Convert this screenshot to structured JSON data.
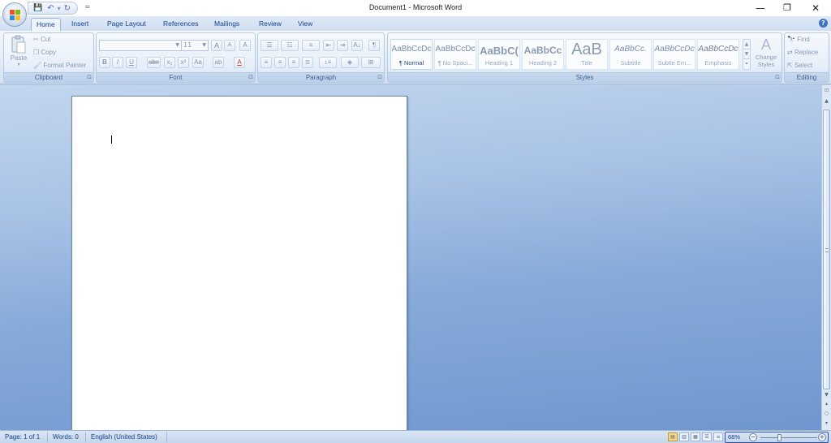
{
  "window": {
    "title": "Document1 - Microsoft Word",
    "controls": {
      "minimize": "—",
      "restore": "❐",
      "close": "✕"
    }
  },
  "quick_access": {
    "save": "💾",
    "undo": "↶",
    "redo": "↻",
    "more": "="
  },
  "tabs": [
    "Home",
    "Insert",
    "Page Layout",
    "References",
    "Mailings",
    "Review",
    "View"
  ],
  "active_tab": "Home",
  "ribbon": {
    "clipboard": {
      "label": "Clipboard",
      "paste": "Paste",
      "cut": "Cut",
      "copy": "Copy",
      "format_painter": "Format Painter"
    },
    "font": {
      "label": "Font",
      "font_name": "",
      "font_size": "11",
      "grow": "A",
      "shrink": "A",
      "clear": "A",
      "bold": "B",
      "italic": "I",
      "underline": "U",
      "strike": "abe",
      "subscript": "x₂",
      "superscript": "x²",
      "change_case": "Aa",
      "highlight": "ab",
      "font_color": "A"
    },
    "paragraph": {
      "label": "Paragraph",
      "show_marks": "¶",
      "sort": "A↓"
    },
    "styles": {
      "label": "Styles",
      "tiles": [
        {
          "sample": "AaBbCcDc",
          "name": "¶ Normal"
        },
        {
          "sample": "AaBbCcDc",
          "name": "¶ No Spaci..."
        },
        {
          "sample": "AaBbC(",
          "name": "Heading 1"
        },
        {
          "sample": "AaBbCc",
          "name": "Heading 2"
        },
        {
          "sample": "AaB",
          "name": "Title"
        },
        {
          "sample": "AaBbCc.",
          "name": "Subtitle"
        },
        {
          "sample": "AaBbCcDc",
          "name": "Subtle Em..."
        },
        {
          "sample": "AaBbCcDc",
          "name": "Emphasis"
        }
      ],
      "change_styles": "Change Styles"
    },
    "editing": {
      "label": "Editing",
      "find": "Find",
      "replace": "Replace",
      "select": "Select"
    }
  },
  "statusbar": {
    "page": "Page: 1 of 1",
    "words": "Words: 0",
    "language": "English (United States)",
    "zoom": "68%",
    "zoom_level": 0.68
  }
}
